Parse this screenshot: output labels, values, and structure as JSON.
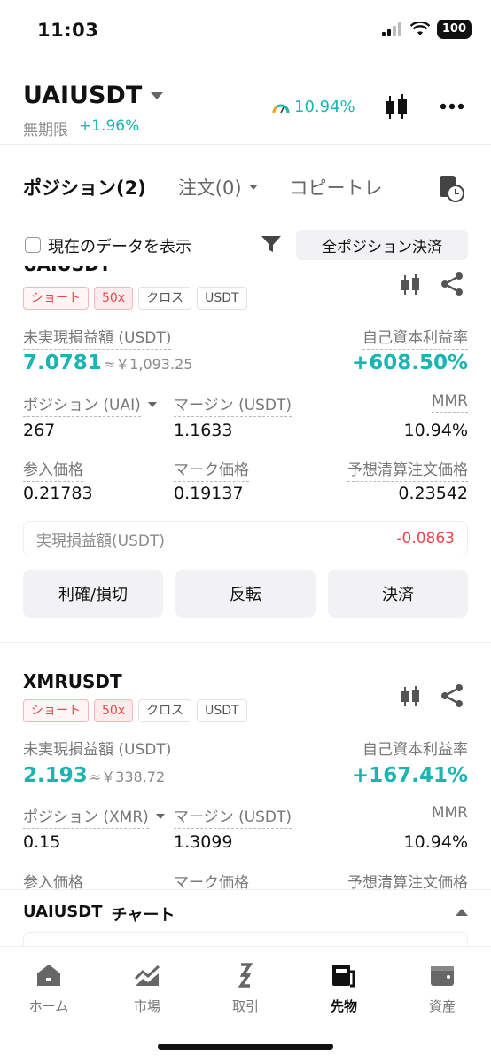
{
  "status": {
    "time": "11:03",
    "battery": "100"
  },
  "header": {
    "symbol": "UAIUSDT",
    "contract_type": "無期限",
    "change": "+1.96%",
    "mmr": "10.94%",
    "icons": [
      "candlestick-icon",
      "more-icon"
    ]
  },
  "tabs": [
    {
      "label": "ポジション(2)",
      "active": true
    },
    {
      "label": "注文(0)"
    },
    {
      "label": "コピートレ"
    }
  ],
  "filter": {
    "show_current_label": "現在のデータを表示",
    "close_all_label": "全ポジション決済"
  },
  "positions": [
    {
      "symbol": "UAIUSDT",
      "tags": [
        "ショート",
        "50x",
        "クロス",
        "USDT"
      ],
      "unrealized_label": "未実現損益額 (USDT)",
      "unrealized_value": "7.0781",
      "unrealized_jpy": "≈￥1,093.25",
      "roe_label": "自己資本利益率",
      "roe_value": "+608.50%",
      "position_label": "ポジション (UAI)",
      "position_value": "267",
      "margin_label": "マージン (USDT)",
      "margin_value": "1.1633",
      "mmr_label": "MMR",
      "mmr_value": "10.94%",
      "entry_label": "参入価格",
      "entry_value": "0.21783",
      "mark_label": "マーク価格",
      "mark_value": "0.19137",
      "liq_label": "予想清算注文価格",
      "liq_value": "0.23542",
      "realized_label": "実現損益額(USDT)",
      "realized_value": "-0.0863",
      "actions": [
        "利確/損切",
        "反転",
        "決済"
      ]
    },
    {
      "symbol": "XMRUSDT",
      "tags": [
        "ショート",
        "50x",
        "クロス",
        "USDT"
      ],
      "unrealized_label": "未実現損益額 (USDT)",
      "unrealized_value": "2.193",
      "unrealized_jpy": "≈￥338.72",
      "roe_label": "自己資本利益率",
      "roe_value": "+167.41%",
      "position_label": "ポジション (XMR)",
      "position_value": "0.15",
      "margin_label": "マージン (USDT)",
      "margin_value": "1.3099",
      "mmr_label": "MMR",
      "mmr_value": "10.94%",
      "entry_label": "参入価格",
      "mark_label": "マーク価格",
      "liq_label": "予想清算注文価格"
    }
  ],
  "chart_bar": {
    "symbol": "UAIUSDT",
    "label": "チャート"
  },
  "tabbar": [
    {
      "label": "ホーム",
      "icon": "home-icon"
    },
    {
      "label": "市場",
      "icon": "market-icon"
    },
    {
      "label": "取引",
      "icon": "trade-icon"
    },
    {
      "label": "先物",
      "icon": "futures-icon",
      "active": true
    },
    {
      "label": "資産",
      "icon": "wallet-icon"
    }
  ]
}
